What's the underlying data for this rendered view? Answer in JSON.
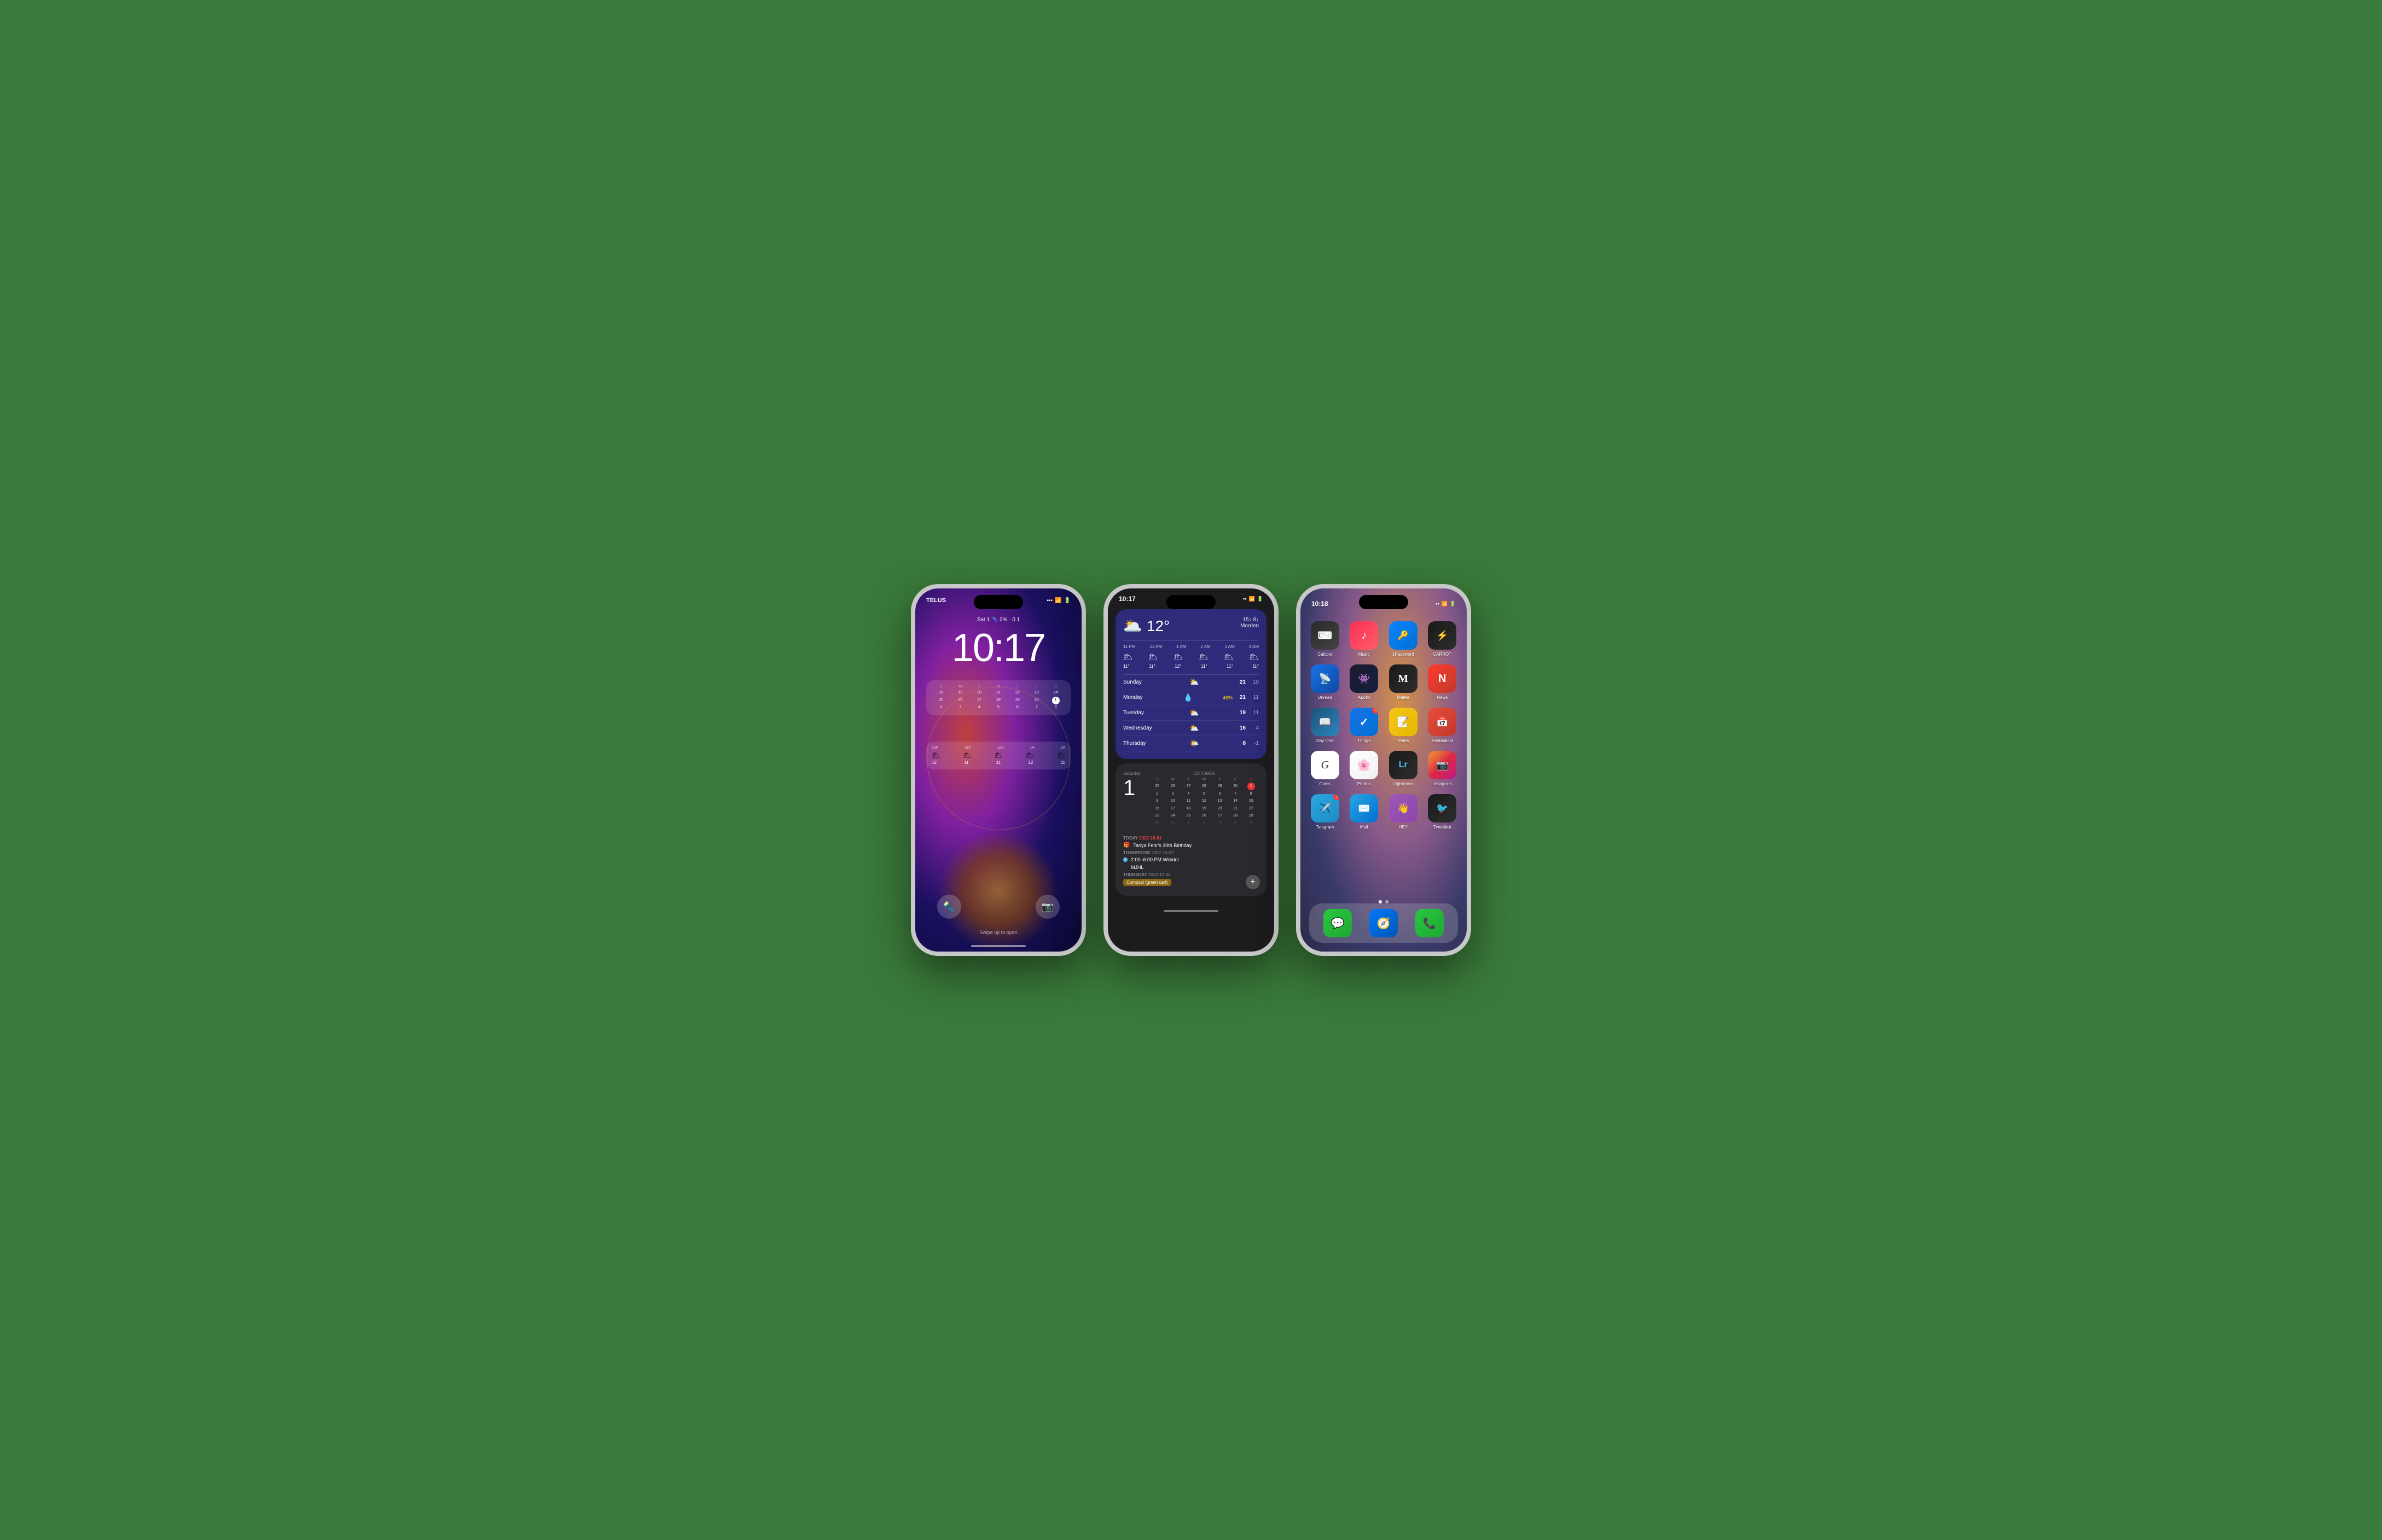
{
  "phone1": {
    "carrier": "TELUS",
    "time": "10:17",
    "weather_summary": "Sat 1 🌂 2% · 0.1",
    "calendar": {
      "header": [
        "S",
        "M",
        "T",
        "W",
        "T",
        "F",
        "S"
      ],
      "weeks": [
        [
          "18",
          "19",
          "20",
          "21",
          "22",
          "23",
          "24"
        ],
        [
          "25",
          "26",
          "27",
          "28",
          "29",
          "30",
          "1"
        ],
        [
          "2",
          "3",
          "4",
          "5",
          "6",
          "7",
          "8"
        ]
      ],
      "today": "1"
    },
    "weather_hours": [
      "10P",
      "11P",
      "12A",
      "1A",
      "2A"
    ],
    "weather_icons": [
      "🌥️",
      "🌥️",
      "🌥️",
      "🌥️",
      "🌥️"
    ],
    "weather_temps": [
      "12",
      "11",
      "11",
      "12",
      "11"
    ],
    "swipe_text": "Swipe up to open"
  },
  "phone2": {
    "time": "10:17",
    "weather": {
      "icon": "🌥️",
      "temp": "12°",
      "high": "15↑",
      "low": "8↓",
      "location": "Morden",
      "hours": [
        "11 PM",
        "12 AM",
        "1 AM",
        "2 AM",
        "3 AM",
        "4 AM"
      ],
      "hour_icons": [
        "🌥️",
        "🌥️",
        "🌥️",
        "🌥️",
        "🌥️",
        "🌥️"
      ],
      "hour_temps": [
        "11°",
        "11°",
        "12°",
        "11°",
        "11°",
        "11°"
      ],
      "forecast": [
        {
          "day": "Sunday",
          "icon": "⛅",
          "pct": "",
          "hi": "21",
          "lo": "10"
        },
        {
          "day": "Monday",
          "icon": "💧",
          "pct": "46%",
          "hi": "21",
          "lo": "11"
        },
        {
          "day": "Tuesday",
          "icon": "⛅",
          "pct": "",
          "hi": "19",
          "lo": "11"
        },
        {
          "day": "Wednesday",
          "icon": "⛅",
          "pct": "",
          "hi": "16",
          "lo": "4"
        },
        {
          "day": "Thursday",
          "icon": "🌤️",
          "pct": "",
          "hi": "8",
          "lo": "-1"
        }
      ]
    },
    "calendar": {
      "month": "OCTOBER",
      "big_date": "1",
      "day_name": "Saturday",
      "headers": [
        "S",
        "M",
        "T",
        "W",
        "T",
        "F",
        "S"
      ],
      "weeks": [
        [
          "25",
          "26",
          "27",
          "28",
          "29",
          "30",
          "1"
        ],
        [
          "2",
          "3",
          "4",
          "5",
          "6",
          "7",
          "8"
        ],
        [
          "9",
          "10",
          "11",
          "12",
          "13",
          "14",
          "15"
        ],
        [
          "16",
          "17",
          "18",
          "19",
          "20",
          "21",
          "22"
        ],
        [
          "23",
          "24",
          "25",
          "26",
          "27",
          "28",
          "29"
        ],
        [
          "30",
          "31",
          "1",
          "2",
          "3",
          "4",
          "5"
        ]
      ],
      "today": "1",
      "events": [
        {
          "day": "TODAY",
          "date": "2022-10-01",
          "icon": "🎁",
          "text": "Tanya Fehr's 30th Birthday",
          "dot_color": ""
        },
        {
          "day": "TOMORROW",
          "date": "2022-10-02",
          "icon": "",
          "text": "2:00–6:00 PM Winkler",
          "dot_color": "#4fc3f7"
        },
        {
          "day": "TOMORROW",
          "date": "",
          "icon": "",
          "text": "MJHL",
          "dot_color": ""
        },
        {
          "day": "THURSDAY",
          "date": "2022-10-06",
          "icon": "",
          "text": "Compost (green cart)",
          "dot_color": "#8B6914"
        }
      ]
    }
  },
  "phone3": {
    "time": "10:18",
    "apps": [
      {
        "name": "Calcbot",
        "label": "Calcbot",
        "bg": "calcbot",
        "icon": "⌨️",
        "badge": ""
      },
      {
        "name": "Music",
        "label": "Music",
        "bg": "music",
        "icon": "🎵",
        "badge": ""
      },
      {
        "name": "1Password",
        "label": "1Password",
        "bg": "1password",
        "icon": "🔐",
        "badge": ""
      },
      {
        "name": "CARROT",
        "label": "CARROT",
        "bg": "carrot",
        "icon": "⚡",
        "badge": ""
      },
      {
        "name": "Unread",
        "label": "Unread",
        "bg": "unread",
        "icon": "📡",
        "badge": ""
      },
      {
        "name": "Apollo",
        "label": "Apollo",
        "bg": "apollo",
        "icon": "👾",
        "badge": ""
      },
      {
        "name": "Matter",
        "label": "Matter",
        "bg": "matter",
        "icon": "M",
        "badge": ""
      },
      {
        "name": "News",
        "label": "News",
        "bg": "news",
        "icon": "N",
        "badge": ""
      },
      {
        "name": "Day One",
        "label": "Day One",
        "bg": "dayone",
        "icon": "📖",
        "badge": ""
      },
      {
        "name": "Things",
        "label": "Things",
        "bg": "things",
        "icon": "✓",
        "badge": "7"
      },
      {
        "name": "Notes",
        "label": "Notes",
        "bg": "notes",
        "icon": "📝",
        "badge": ""
      },
      {
        "name": "Fantastical",
        "label": "Fantastical",
        "bg": "fantastical",
        "icon": "📅",
        "badge": ""
      },
      {
        "name": "Glass",
        "label": "Glass",
        "bg": "glass",
        "icon": "G",
        "badge": ""
      },
      {
        "name": "Photos",
        "label": "Photos",
        "bg": "photos",
        "icon": "🌸",
        "badge": ""
      },
      {
        "name": "Lightroom",
        "label": "Lightroom",
        "bg": "lightroom",
        "icon": "Lr",
        "badge": ""
      },
      {
        "name": "Instagram",
        "label": "Instagram",
        "bg": "instagram",
        "icon": "📷",
        "badge": ""
      },
      {
        "name": "Telegram",
        "label": "Telegram",
        "bg": "telegram",
        "icon": "✈️",
        "badge": "1"
      },
      {
        "name": "Mail",
        "label": "Mail",
        "bg": "mail",
        "icon": "✉️",
        "badge": ""
      },
      {
        "name": "HEY",
        "label": "HEY",
        "bg": "hey",
        "icon": "👋",
        "badge": ""
      },
      {
        "name": "Tweetbot",
        "label": "Tweetbot",
        "bg": "tweetbot",
        "icon": "🐦",
        "badge": ""
      }
    ],
    "dock": [
      {
        "name": "Messages",
        "label": "Messages",
        "bg": "#28c840",
        "icon": "💬"
      },
      {
        "name": "Safari",
        "label": "Safari",
        "bg": "#007aff",
        "icon": "🧭"
      },
      {
        "name": "Phone",
        "label": "Phone",
        "bg": "#28c840",
        "icon": "📞"
      }
    ]
  }
}
